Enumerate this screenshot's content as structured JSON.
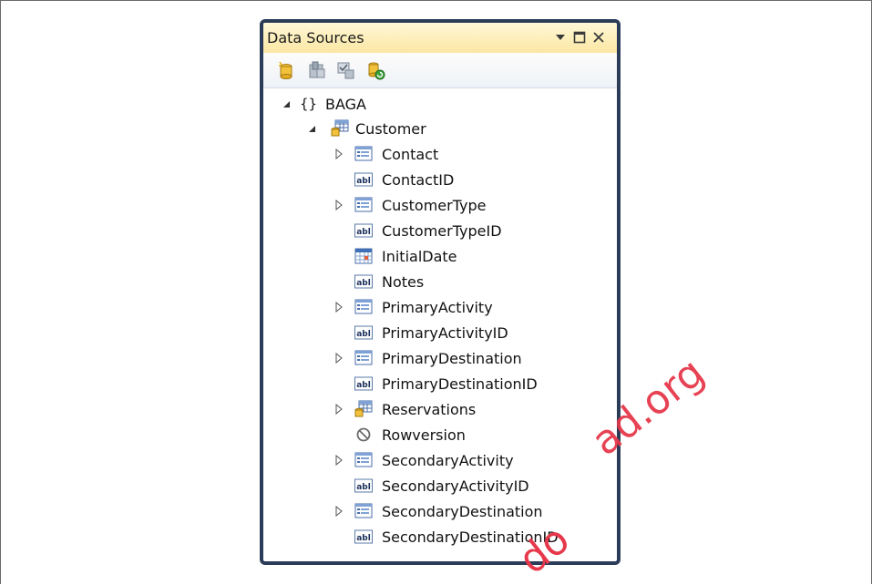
{
  "panel": {
    "title": "Data Sources",
    "buttons": [
      {
        "name": "dropdown-arrow-icon",
        "glyph": "▾"
      },
      {
        "name": "maximize-icon",
        "glyph": "▢"
      },
      {
        "name": "close-icon",
        "glyph": "✕"
      }
    ]
  },
  "toolbar": {
    "tools": [
      {
        "name": "add-new-data-source-icon"
      },
      {
        "name": "edit-dataset-designer-icon"
      },
      {
        "name": "configure-dataset-wizard-icon"
      },
      {
        "name": "refresh-icon"
      }
    ]
  },
  "tree": {
    "root": {
      "label": "BAGA"
    },
    "entity": {
      "label": "Customer"
    },
    "items": [
      {
        "label": "Contact",
        "type": "navigation",
        "expandable": true
      },
      {
        "label": "ContactID",
        "type": "text",
        "expandable": false
      },
      {
        "label": "CustomerType",
        "type": "navigation",
        "expandable": true
      },
      {
        "label": "CustomerTypeID",
        "type": "text",
        "expandable": false
      },
      {
        "label": "InitialDate",
        "type": "date",
        "expandable": false
      },
      {
        "label": "Notes",
        "type": "text",
        "expandable": false
      },
      {
        "label": "PrimaryActivity",
        "type": "navigation",
        "expandable": true
      },
      {
        "label": "PrimaryActivityID",
        "type": "text",
        "expandable": false
      },
      {
        "label": "PrimaryDestination",
        "type": "navigation",
        "expandable": true
      },
      {
        "label": "PrimaryDestinationID",
        "type": "text",
        "expandable": false
      },
      {
        "label": "Reservations",
        "type": "collection",
        "expandable": true
      },
      {
        "label": "Rowversion",
        "type": "none",
        "expandable": false
      },
      {
        "label": "SecondaryActivity",
        "type": "navigation",
        "expandable": true
      },
      {
        "label": "SecondaryActivityID",
        "type": "text",
        "expandable": false
      },
      {
        "label": "SecondaryDestination",
        "type": "navigation",
        "expandable": true
      },
      {
        "label": "SecondaryDestinationID",
        "type": "text",
        "expandable": false
      }
    ]
  },
  "watermark": {
    "text1": "ad.org",
    "text2": "do"
  }
}
